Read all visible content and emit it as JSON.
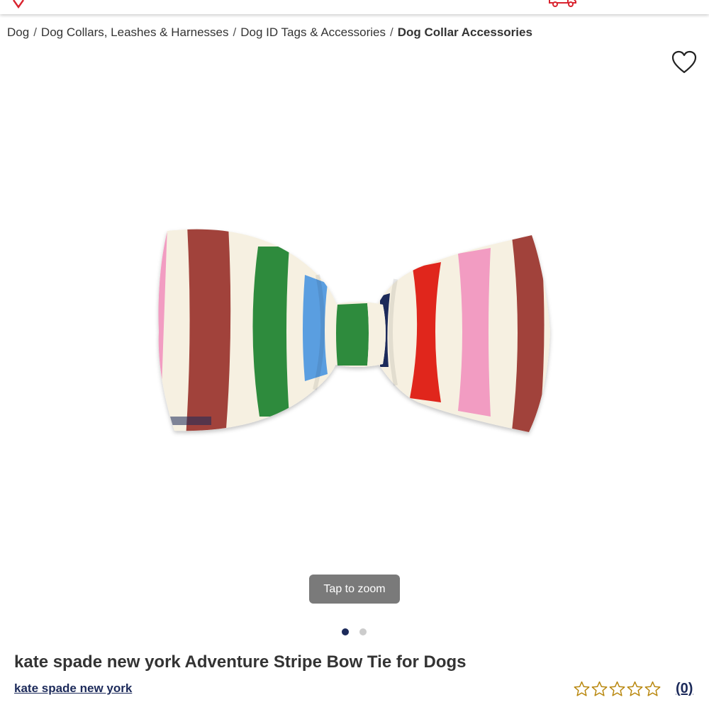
{
  "breadcrumb": {
    "items": [
      "Dog",
      "Dog Collars, Leashes & Harnesses",
      "Dog ID Tags & Accessories"
    ],
    "current": "Dog Collar Accessories",
    "separator": "/"
  },
  "gallery": {
    "zoom_label": "Tap to zoom",
    "current_image": 1,
    "image_count": 2
  },
  "product": {
    "title": "kate spade new york Adventure Stripe Bow Tie for Dogs",
    "brand": "kate spade new york",
    "rating": 0,
    "rating_max": 5,
    "review_count_label": "(0)"
  },
  "colors": {
    "accent_red": "#d9232e",
    "brand_navy": "#1c2a5a",
    "star_gold": "#b8860b",
    "stripe_brown": "#a1423a",
    "stripe_green": "#2e8b3e",
    "stripe_blue": "#5a9ee0",
    "stripe_red": "#e0261e",
    "stripe_pink": "#f29cc2",
    "stripe_cream": "#f6f0e1"
  },
  "icons": [
    "logo-icon",
    "delivery-truck-icon",
    "heart-icon",
    "star-icon"
  ]
}
